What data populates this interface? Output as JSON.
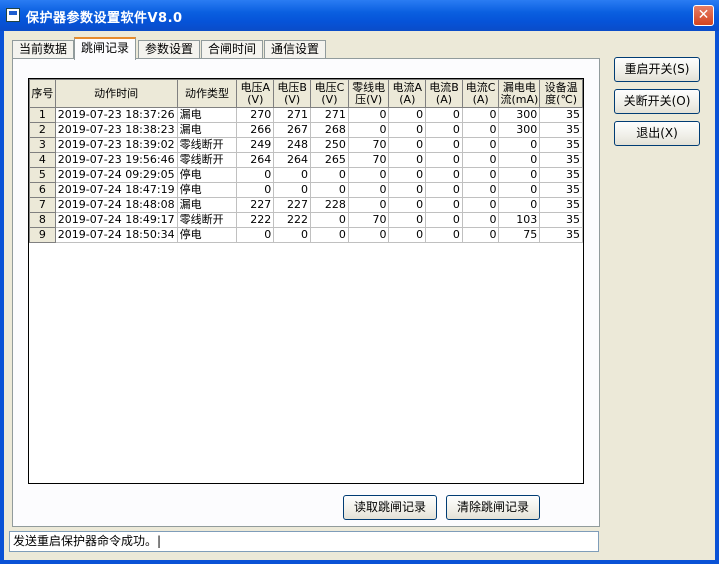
{
  "window": {
    "title": "保护器参数设置软件V8.0",
    "close_label": "✕"
  },
  "tabs": [
    {
      "label": "当前数据"
    },
    {
      "label": "跳闸记录"
    },
    {
      "label": "参数设置"
    },
    {
      "label": "合闸时间"
    },
    {
      "label": "通信设置"
    }
  ],
  "table": {
    "headers": [
      "序号",
      "动作时间",
      "动作类型",
      "电压A (V)",
      "电压B (V)",
      "电压C (V)",
      "零线电压(V)",
      "电流A (A)",
      "电流B (A)",
      "电流C (A)",
      "漏电电流(mA)",
      "设备温度(℃)"
    ],
    "rows": [
      [
        "1",
        "2019-07-23 18:37:26",
        "漏电",
        "270",
        "271",
        "271",
        "0",
        "0",
        "0",
        "0",
        "300",
        "35"
      ],
      [
        "2",
        "2019-07-23 18:38:23",
        "漏电",
        "266",
        "267",
        "268",
        "0",
        "0",
        "0",
        "0",
        "300",
        "35"
      ],
      [
        "3",
        "2019-07-23 18:39:02",
        "零线断开",
        "249",
        "248",
        "250",
        "70",
        "0",
        "0",
        "0",
        "0",
        "35"
      ],
      [
        "4",
        "2019-07-23 19:56:46",
        "零线断开",
        "264",
        "264",
        "265",
        "70",
        "0",
        "0",
        "0",
        "0",
        "35"
      ],
      [
        "5",
        "2019-07-24 09:29:05",
        "停电",
        "0",
        "0",
        "0",
        "0",
        "0",
        "0",
        "0",
        "0",
        "35"
      ],
      [
        "6",
        "2019-07-24 18:47:19",
        "停电",
        "0",
        "0",
        "0",
        "0",
        "0",
        "0",
        "0",
        "0",
        "35"
      ],
      [
        "7",
        "2019-07-24 18:48:08",
        "漏电",
        "227",
        "227",
        "228",
        "0",
        "0",
        "0",
        "0",
        "0",
        "35"
      ],
      [
        "8",
        "2019-07-24 18:49:17",
        "零线断开",
        "222",
        "222",
        "0",
        "70",
        "0",
        "0",
        "0",
        "103",
        "35"
      ],
      [
        "9",
        "2019-07-24 18:50:34",
        "停电",
        "0",
        "0",
        "0",
        "0",
        "0",
        "0",
        "0",
        "75",
        "35"
      ]
    ]
  },
  "buttons": {
    "restart": "重启开关(S)",
    "shutdown": "关断开关(O)",
    "exit": "退出(X)",
    "read_records": "读取跳闸记录",
    "clear_records": "清除跳闸记录"
  },
  "status": {
    "text": "发送重启保护器命令成功。|"
  }
}
